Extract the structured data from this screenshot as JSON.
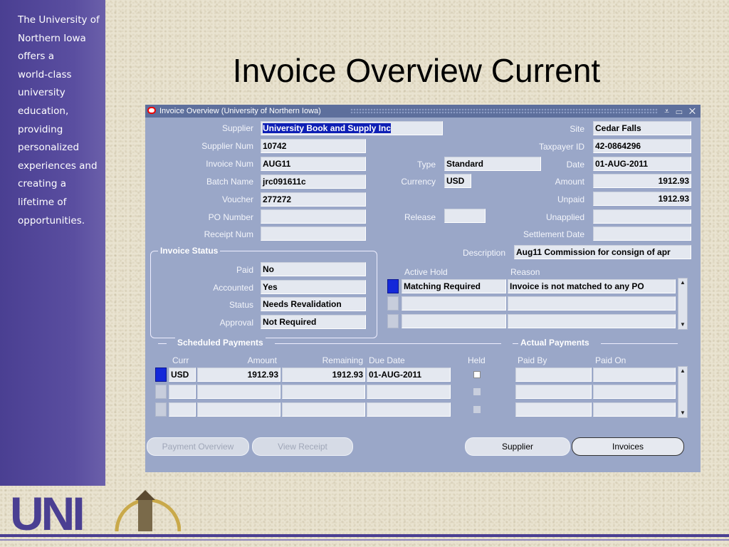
{
  "sidebar": {
    "lines": [
      "The University of",
      "Northern Iowa",
      "offers a",
      "world-class",
      "university",
      "education,",
      "providing",
      "personalized",
      "experiences and",
      "creating a",
      "lifetime of",
      "opportunities."
    ]
  },
  "slide": {
    "title": "Invoice Overview Current"
  },
  "window": {
    "title": "Invoice Overview (University of Northern Iowa)",
    "controls": "⩡ ▭ ✕"
  },
  "fields": {
    "supplier": {
      "label": "Supplier",
      "value": "University Book and Supply Inc"
    },
    "supplier_num": {
      "label": "Supplier Num",
      "value": "10742"
    },
    "invoice_num": {
      "label": "Invoice Num",
      "value": "AUG11"
    },
    "batch_name": {
      "label": "Batch Name",
      "value": "jrc091611c"
    },
    "voucher": {
      "label": "Voucher",
      "value": "277272"
    },
    "po_number": {
      "label": "PO Number",
      "value": ""
    },
    "receipt_num": {
      "label": "Receipt Num",
      "value": ""
    },
    "type": {
      "label": "Type",
      "value": "Standard"
    },
    "currency": {
      "label": "Currency",
      "value": "USD"
    },
    "release": {
      "label": "Release",
      "value": ""
    },
    "site": {
      "label": "Site",
      "value": "Cedar Falls"
    },
    "taxpayer_id": {
      "label": "Taxpayer ID",
      "value": "42-0864296"
    },
    "date": {
      "label": "Date",
      "value": "01-AUG-2011"
    },
    "amount": {
      "label": "Amount",
      "value": "1912.93"
    },
    "unpaid": {
      "label": "Unpaid",
      "value": "1912.93"
    },
    "unapplied": {
      "label": "Unapplied",
      "value": ""
    },
    "settlement_date": {
      "label": "Settlement Date",
      "value": ""
    },
    "description": {
      "label": "Description",
      "value": "Aug11 Commission for consign of apr"
    }
  },
  "invoice_status": {
    "title": "Invoice Status",
    "paid": {
      "label": "Paid",
      "value": "No"
    },
    "accounted": {
      "label": "Accounted",
      "value": "Yes"
    },
    "status": {
      "label": "Status",
      "value": "Needs Revalidation"
    },
    "approval": {
      "label": "Approval",
      "value": "Not Required"
    }
  },
  "holds": {
    "col_active_hold": "Active Hold",
    "col_reason": "Reason",
    "rows": [
      {
        "hold": "Matching Required",
        "reason": "Invoice is not matched to any PO"
      },
      {
        "hold": "",
        "reason": ""
      },
      {
        "hold": "",
        "reason": ""
      }
    ]
  },
  "scheduled_payments": {
    "title": "Scheduled Payments",
    "cols": {
      "curr": "Curr",
      "amount": "Amount",
      "remaining": "Remaining",
      "due_date": "Due Date",
      "held": "Held"
    },
    "rows": [
      {
        "curr": "USD",
        "amount": "1912.93",
        "remaining": "1912.93",
        "due_date": "01-AUG-2011"
      },
      {
        "curr": "",
        "amount": "",
        "remaining": "",
        "due_date": ""
      },
      {
        "curr": "",
        "amount": "",
        "remaining": "",
        "due_date": ""
      }
    ]
  },
  "actual_payments": {
    "title": "Actual Payments",
    "cols": {
      "paid_by": "Paid By",
      "paid_on": "Paid On"
    }
  },
  "buttons": {
    "payment_overview": "Payment Overview",
    "view_receipt": "View Receipt",
    "supplier": "Supplier",
    "invoices": "Invoices"
  },
  "logo": {
    "text": "UNI"
  },
  "colors": {
    "sidebar": "#4a3f92",
    "window": "#9aa7c8",
    "titlebar": "#5d6f9c",
    "active_indicator": "#1428d9"
  }
}
